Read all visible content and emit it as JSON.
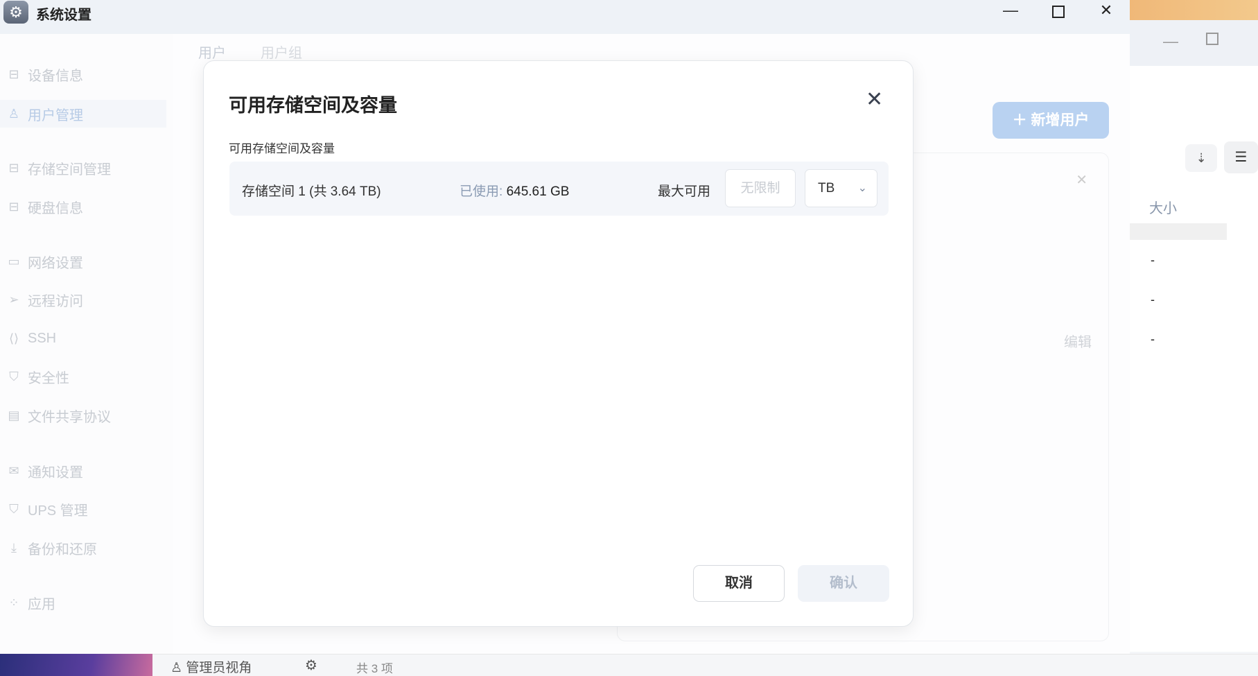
{
  "window": {
    "title": "系统设置",
    "app_icon": "gear-icon"
  },
  "sidebar": {
    "items": [
      {
        "label": "设备信息",
        "icon": "drive-icon"
      },
      {
        "label": "用户管理",
        "icon": "users-icon"
      },
      {
        "label": "存储空间管理",
        "icon": "storage-icon"
      },
      {
        "label": "硬盘信息",
        "icon": "disk-icon"
      },
      {
        "label": "网络设置",
        "icon": "network-icon"
      },
      {
        "label": "远程访问",
        "icon": "send-icon"
      },
      {
        "label": "SSH",
        "icon": "code-icon"
      },
      {
        "label": "安全性",
        "icon": "shield-check-icon"
      },
      {
        "label": "文件共享协议",
        "icon": "document-icon"
      },
      {
        "label": "通知设置",
        "icon": "mail-icon"
      },
      {
        "label": "UPS 管理",
        "icon": "shield-icon"
      },
      {
        "label": "备份和还原",
        "icon": "download-icon"
      },
      {
        "label": "应用",
        "icon": "apps-icon"
      }
    ]
  },
  "background": {
    "tabs": [
      "用户",
      "用户组"
    ],
    "add_user": "新增用户",
    "edit": "编辑",
    "size_header": "大小",
    "dashes": [
      "-",
      "-",
      "-"
    ]
  },
  "dialog": {
    "title": "可用存储空间及容量",
    "subtitle": "可用存储空间及容量",
    "row": {
      "name": "存储空间 1 (共 3.64 TB)",
      "used_label": "已使用:",
      "used_value": "645.61 GB",
      "max_label": "最大可用",
      "max_placeholder": "无限制",
      "unit": "TB"
    },
    "cancel": "取消",
    "confirm": "确认"
  },
  "taskbar": {
    "view": "管理员视角",
    "count": "共 3 项"
  }
}
